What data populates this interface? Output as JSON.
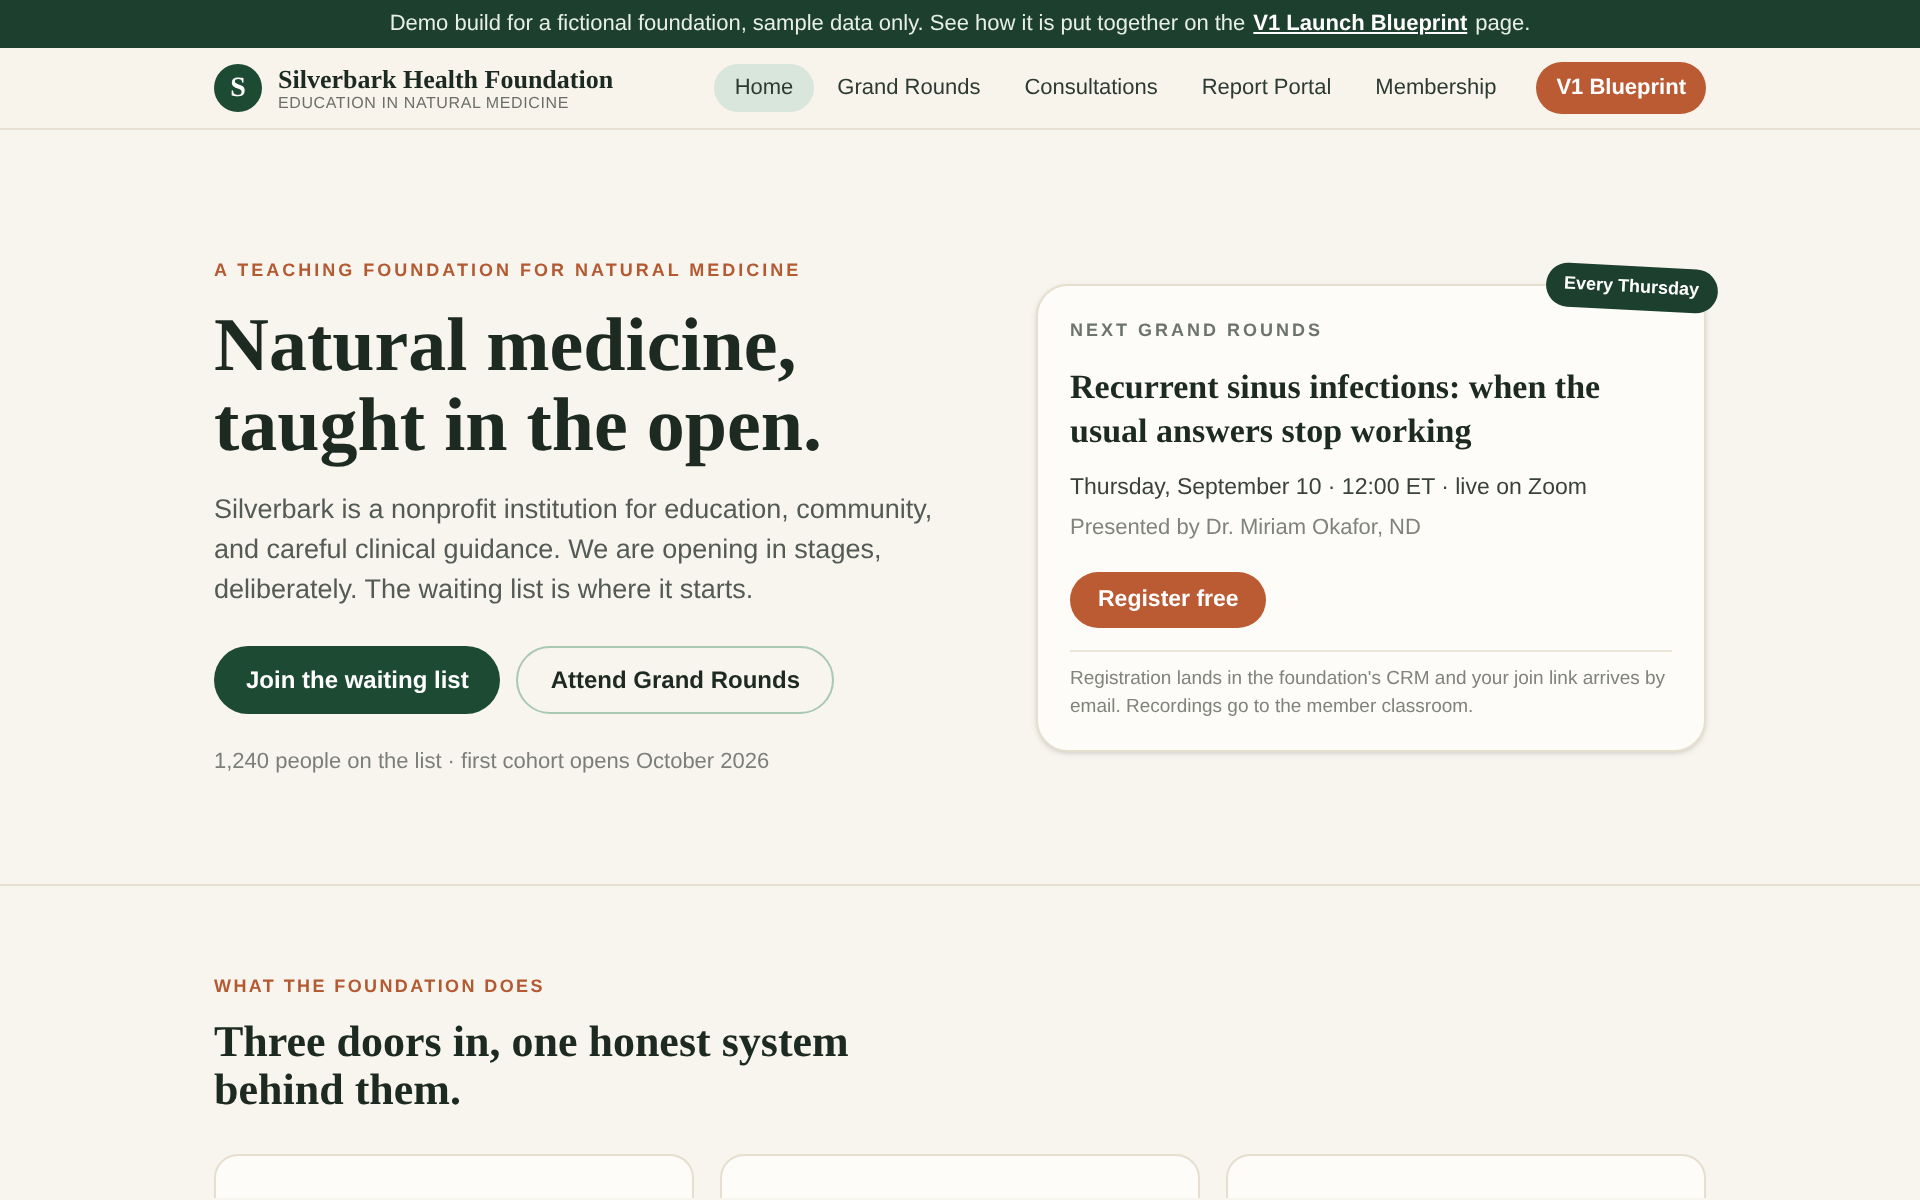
{
  "banner": {
    "text": "Demo build for a fictional foundation, sample data only. See how it is put together on the",
    "link": "V1 Launch Blueprint",
    "suffix": "page."
  },
  "header": {
    "logo_letter": "S",
    "name": "Silverbark Health Foundation",
    "tagline": "EDUCATION IN NATURAL MEDICINE",
    "nav": [
      {
        "label": "Home",
        "selected": true
      },
      {
        "label": "Grand Rounds",
        "selected": false
      },
      {
        "label": "Consultations",
        "selected": false
      },
      {
        "label": "Report Portal",
        "selected": false
      },
      {
        "label": "Membership",
        "selected": false
      }
    ],
    "cta": "V1 Blueprint"
  },
  "hero": {
    "eyebrow": "A TEACHING FOUNDATION FOR NATURAL MEDICINE",
    "title_lines": [
      "Natural medicine,",
      "taught in the open."
    ],
    "body": "Silverbark is a nonprofit institution for education, community, and careful clinical guidance. We are opening in stages, deliberately. The waiting list is where it starts.",
    "buttons": [
      {
        "label": "Join the waiting list",
        "kind": "primary"
      },
      {
        "label": "Attend Grand Rounds",
        "kind": "outline"
      }
    ],
    "note": "1,240 people on the list · first cohort opens October 2026"
  },
  "event_card": {
    "badge": "Every Thursday",
    "eyebrow": "NEXT GRAND ROUNDS",
    "title": "Recurrent sinus infections: when the usual answers stop working",
    "when": "Thursday, September 10 · 12:00 ET · live on Zoom",
    "presenter": "Presented by Dr. Miriam Okafor, ND",
    "button": "Register free",
    "footnote": "Registration lands in the foundation's CRM and your join link arrives by email. Recordings go to the member classroom."
  },
  "section": {
    "eyebrow": "WHAT THE FOUNDATION DOES",
    "title": "Three doors in, one honest system behind them."
  }
}
